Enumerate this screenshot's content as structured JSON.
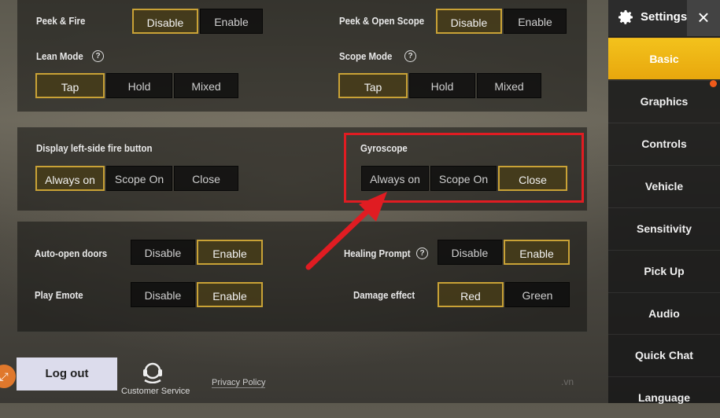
{
  "settings_panel": {
    "peek_fire": {
      "label": "Peek & Fire",
      "options": [
        "Disable",
        "Enable"
      ],
      "selected": "Disable"
    },
    "peek_open_scope": {
      "label": "Peek & Open Scope",
      "options": [
        "Disable",
        "Enable"
      ],
      "selected": "Disable"
    },
    "lean_mode": {
      "label": "Lean Mode",
      "help": "?",
      "options": [
        "Tap",
        "Hold",
        "Mixed"
      ],
      "selected": "Tap"
    },
    "scope_mode": {
      "label": "Scope Mode",
      "help": "?",
      "options": [
        "Tap",
        "Hold",
        "Mixed"
      ],
      "selected": "Tap"
    },
    "left_fire": {
      "label": "Display left-side fire button",
      "options": [
        "Always on",
        "Scope On",
        "Close"
      ],
      "selected": "Always on"
    },
    "gyroscope": {
      "label": "Gyroscope",
      "options": [
        "Always on",
        "Scope On",
        "Close"
      ],
      "selected": "Close"
    },
    "auto_open_doors": {
      "label": "Auto-open doors",
      "options": [
        "Disable",
        "Enable"
      ],
      "selected": "Enable"
    },
    "healing_prompt": {
      "label": "Healing Prompt",
      "help": "?",
      "options": [
        "Disable",
        "Enable"
      ],
      "selected": "Enable"
    },
    "play_emote": {
      "label": "Play Emote",
      "options": [
        "Disable",
        "Enable"
      ],
      "selected": "Enable"
    },
    "damage_effect": {
      "label": "Damage effect",
      "options": [
        "Red",
        "Green"
      ],
      "selected": "Red"
    }
  },
  "sidebar": {
    "title": "Settings",
    "close_icon": "×",
    "items": [
      "Basic",
      "Graphics",
      "Controls",
      "Vehicle",
      "Sensitivity",
      "Pick Up",
      "Audio",
      "Quick Chat",
      "Language"
    ],
    "active": "Basic"
  },
  "footer": {
    "logout": "Log out",
    "customer_service": "Customer Service",
    "privacy_policy": "Privacy Policy",
    "watermark": ".vn"
  },
  "colors": {
    "accent": "#f3c21c",
    "highlight": "#e01c22",
    "selected_border": "#c9a236"
  }
}
